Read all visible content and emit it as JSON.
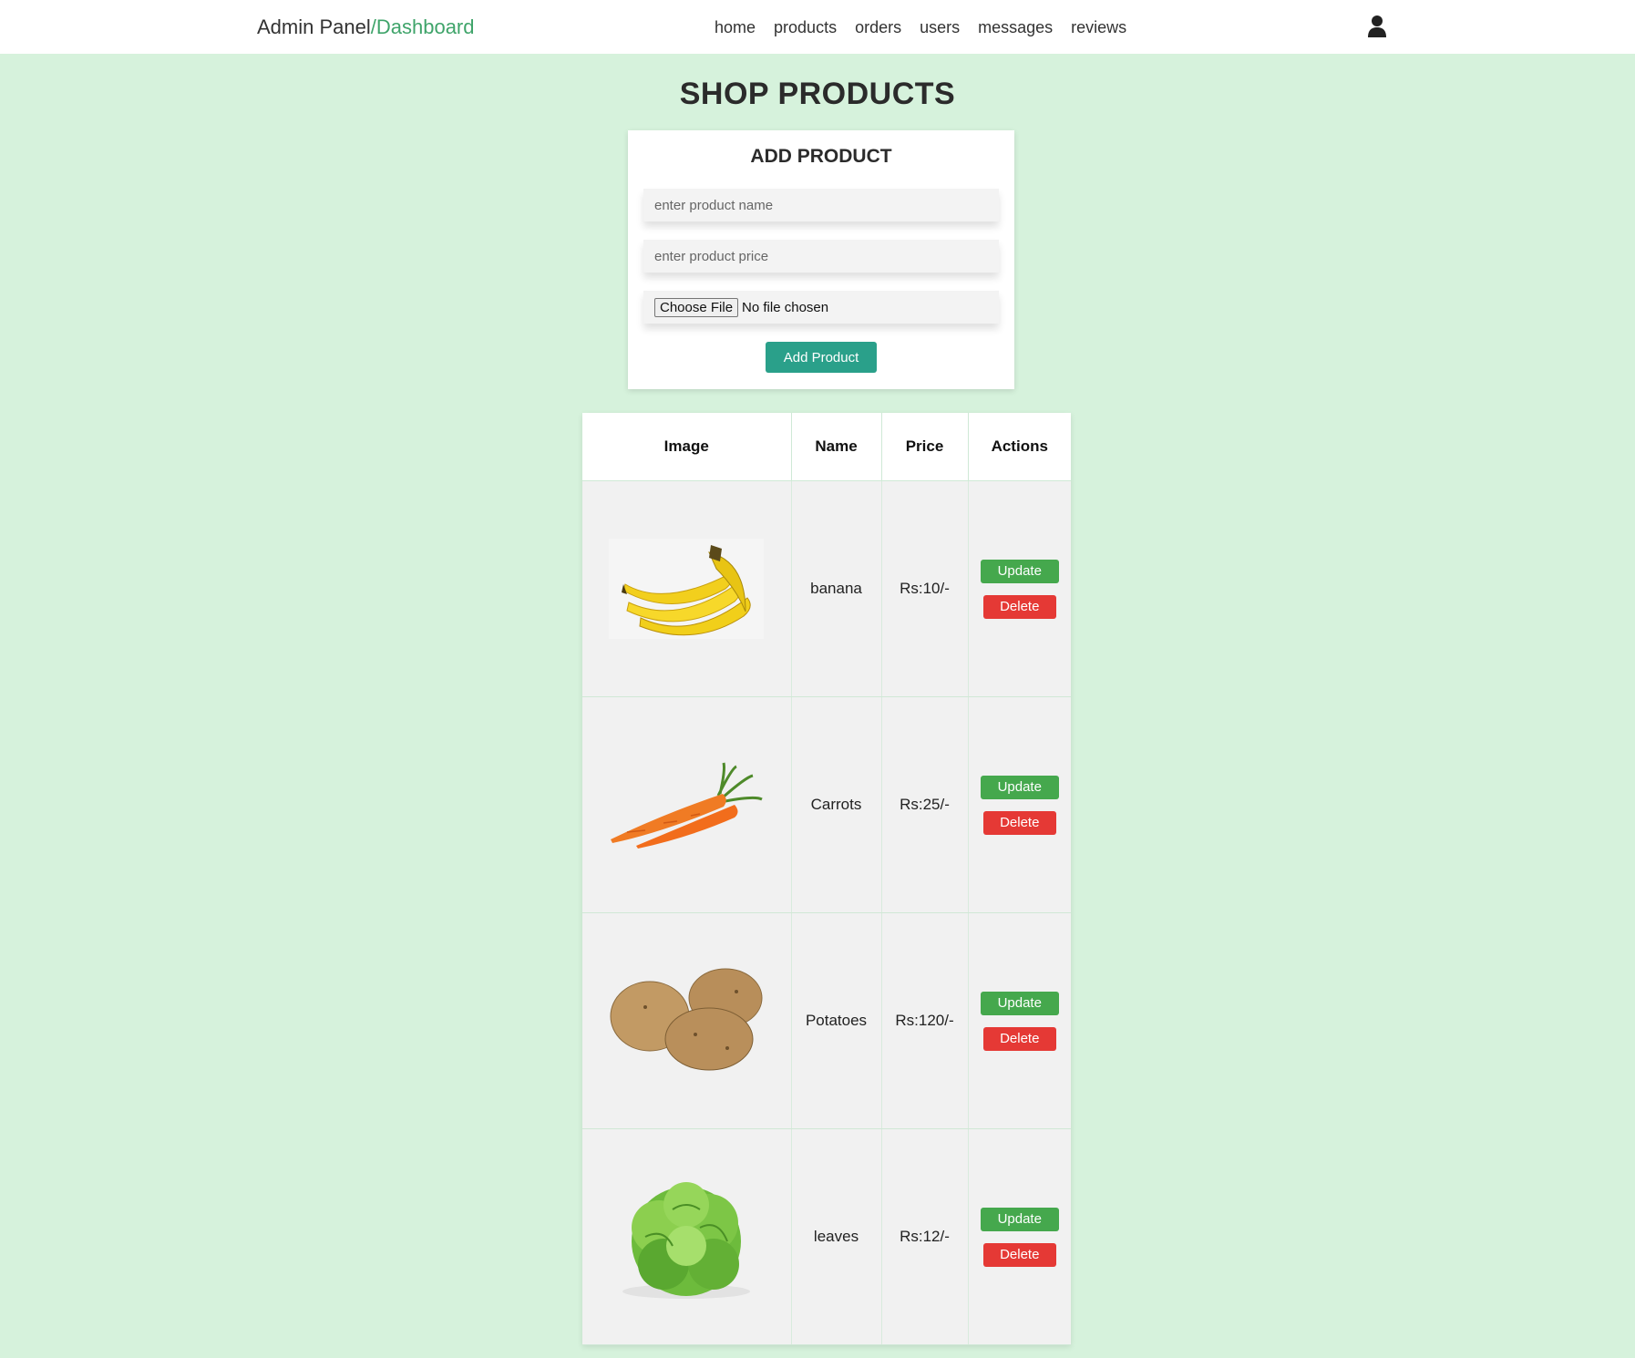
{
  "header": {
    "brand_main": "Admin Panel",
    "brand_accent": "/Dashboard",
    "nav": [
      "home",
      "products",
      "orders",
      "users",
      "messages",
      "reviews"
    ],
    "user_icon": "user-icon"
  },
  "page": {
    "title": "SHOP PRODUCTS"
  },
  "add_form": {
    "title": "ADD PRODUCT",
    "name_placeholder": "enter product name",
    "price_placeholder": "enter product price",
    "file_button": "Choose File",
    "file_status": "No file chosen",
    "submit_label": "Add Product"
  },
  "table": {
    "headers": [
      "Image",
      "Name",
      "Price",
      "Actions"
    ],
    "rows": [
      {
        "image": "banana-image",
        "name": "banana",
        "price": "Rs:10/-",
        "update": "Update",
        "delete": "Delete"
      },
      {
        "image": "carrots-image",
        "name": "Carrots",
        "price": "Rs:25/-",
        "update": "Update",
        "delete": "Delete"
      },
      {
        "image": "potatoes-image",
        "name": "Potatoes",
        "price": "Rs:120/-",
        "update": "Update",
        "delete": "Delete"
      },
      {
        "image": "lettuce-image",
        "name": "leaves",
        "price": "Rs:12/-",
        "update": "Update",
        "delete": "Delete"
      }
    ]
  },
  "colors": {
    "background": "#d6f2dc",
    "accent": "#3fa46a",
    "add_button": "#2aa08a",
    "update_button": "#45a84d",
    "delete_button": "#e53935"
  }
}
